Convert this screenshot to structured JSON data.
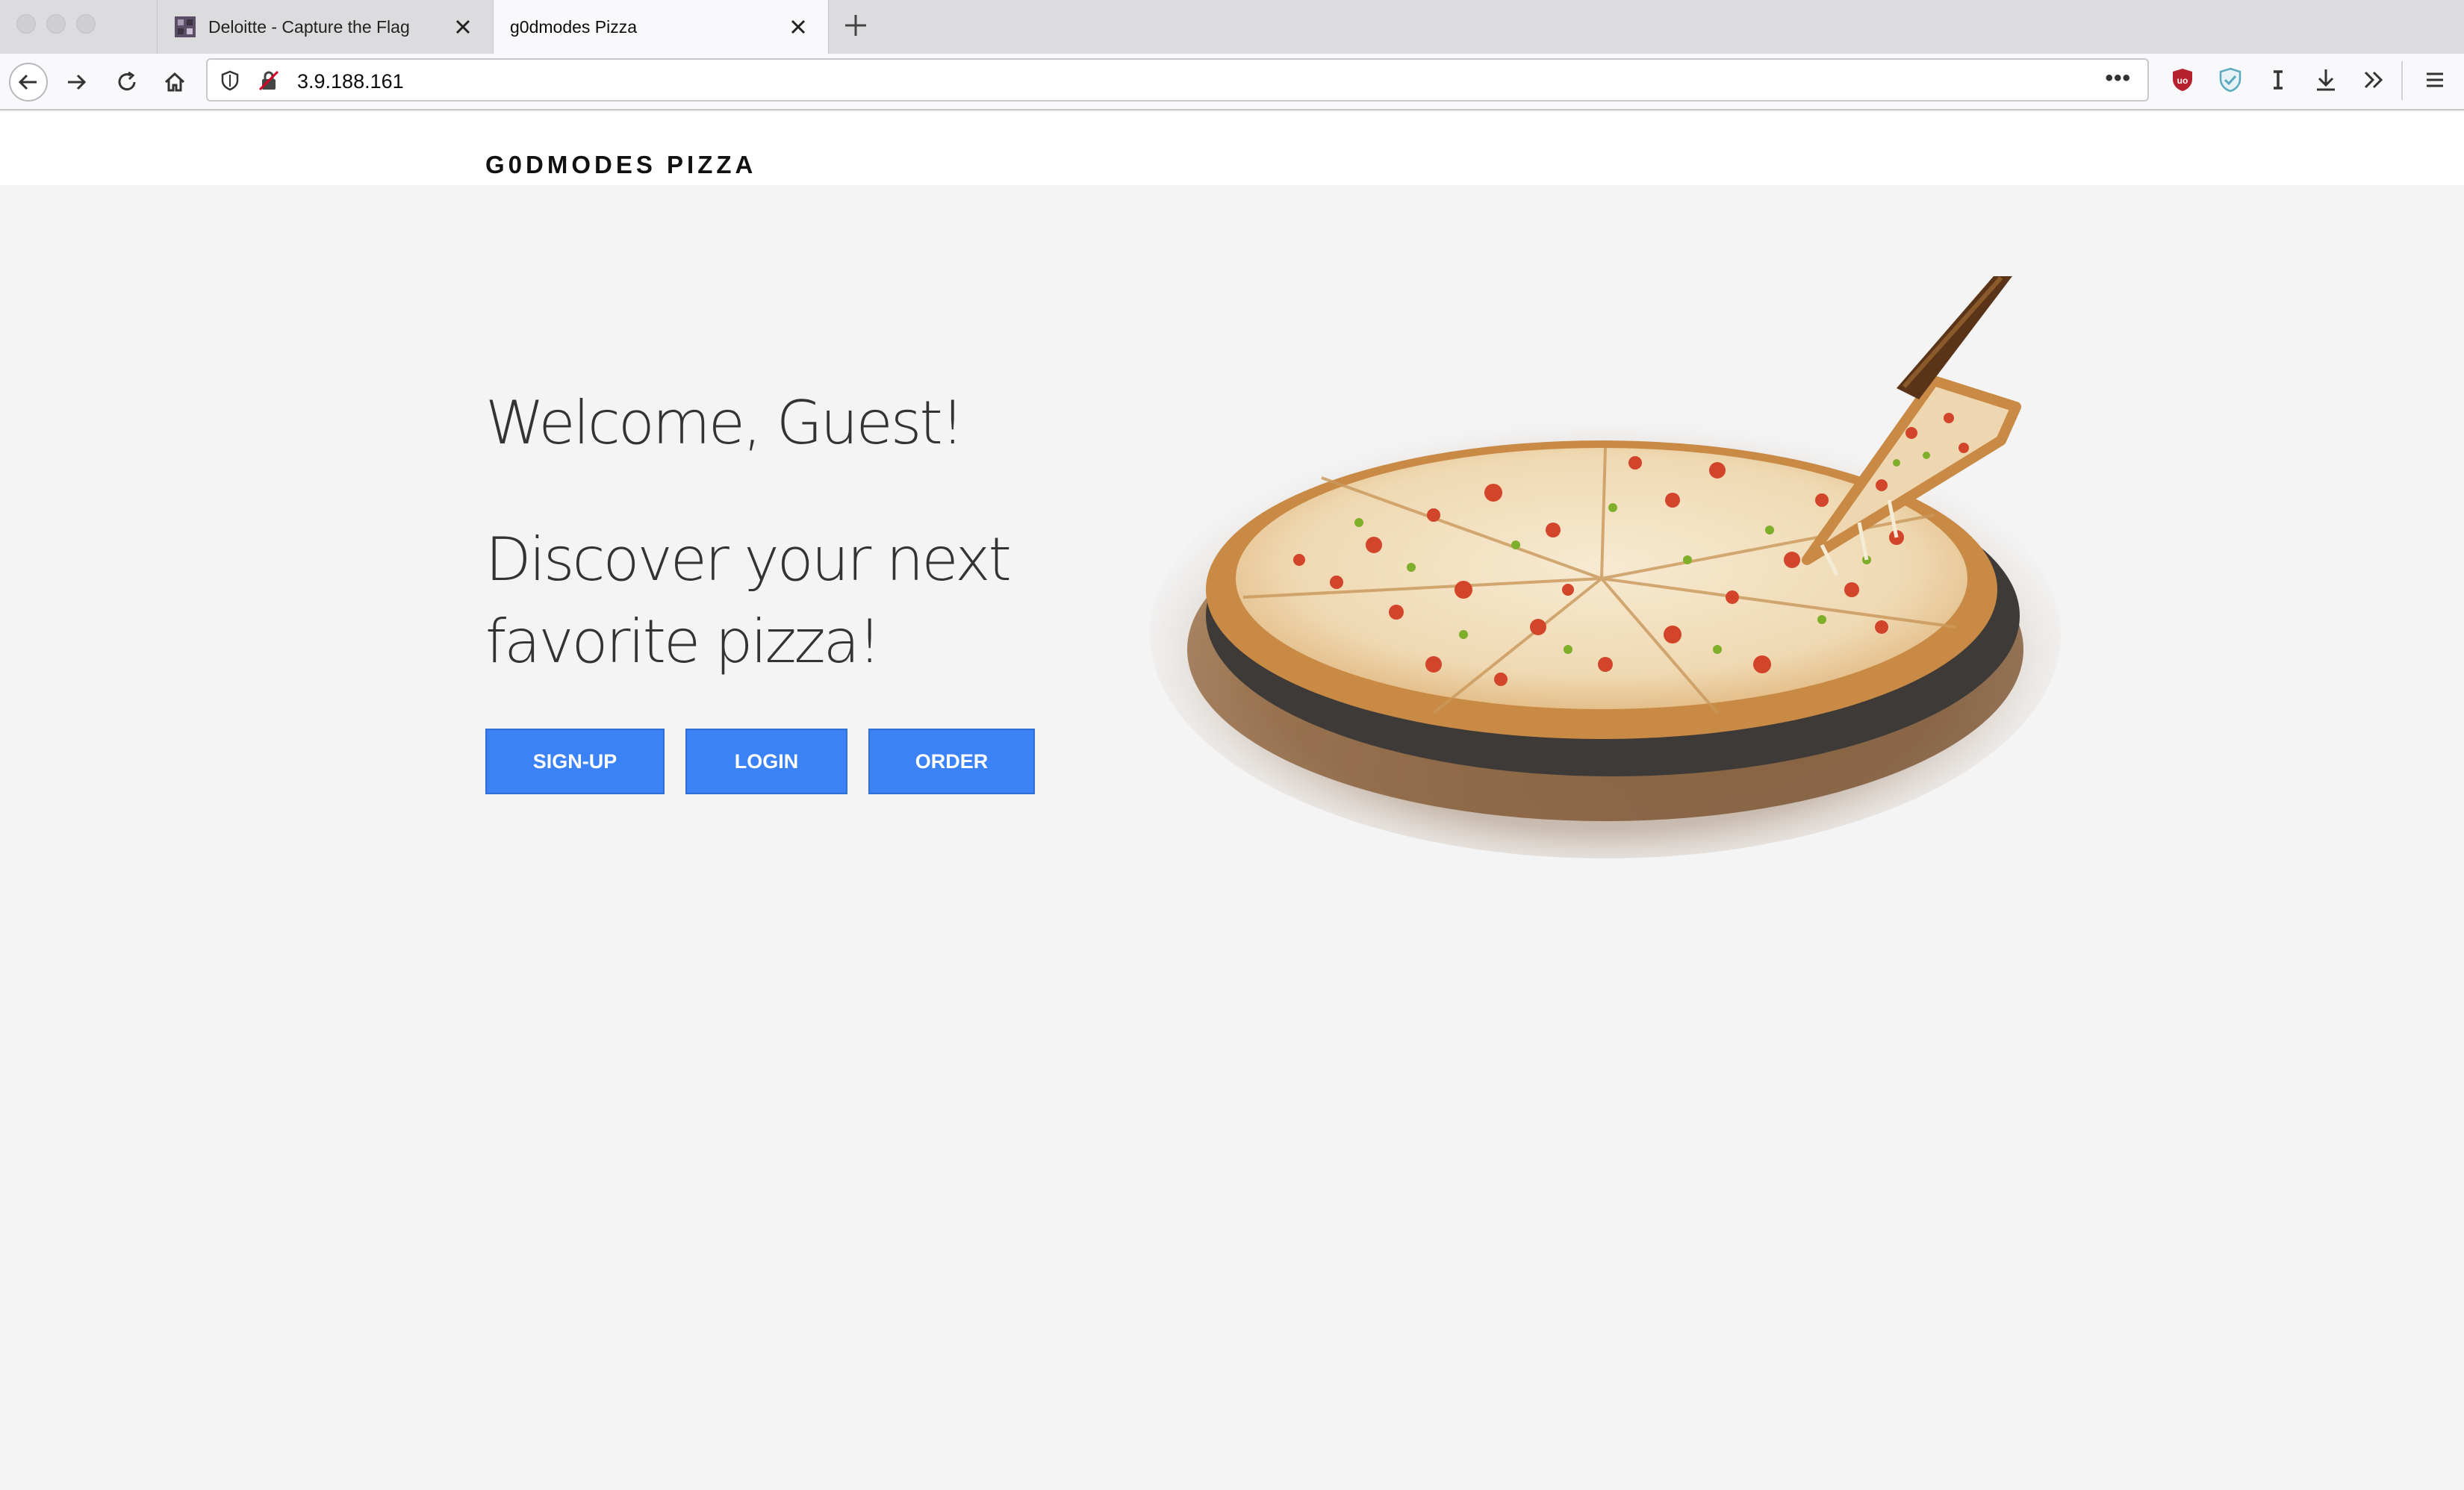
{
  "browser": {
    "tabs": [
      {
        "title": "Deloitte - Capture the Flag",
        "active": false
      },
      {
        "title": "g0dmodes Pizza",
        "active": true
      }
    ],
    "url": "3.9.188.161",
    "more_label": "•••"
  },
  "page": {
    "brand": "G0DMODES PIZZA",
    "welcome": "Welcome, Guest!",
    "tagline": "Discover your next favorite pizza!",
    "buttons": {
      "signup": "SIGN-UP",
      "login": "LOGIN",
      "order": "ORDER"
    }
  },
  "colors": {
    "accent": "#3b82f6",
    "page_bg": "#f4f4f4"
  }
}
